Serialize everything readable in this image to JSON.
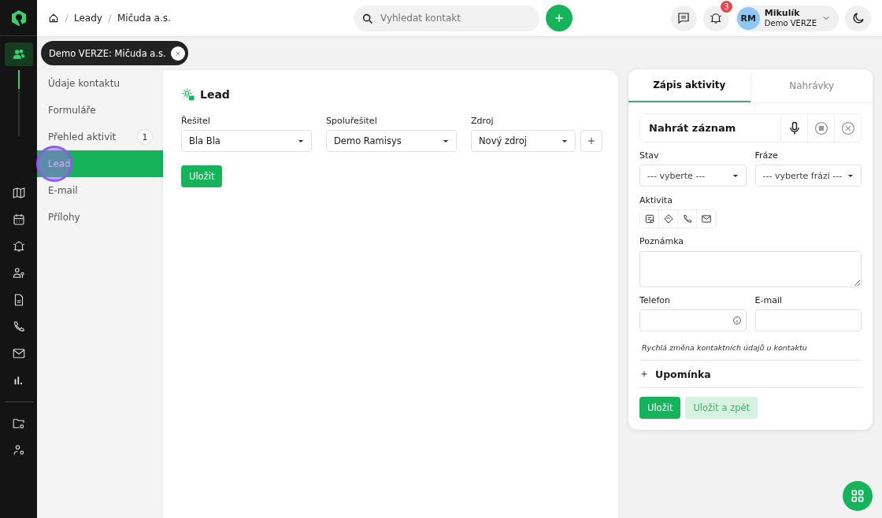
{
  "rail": {
    "items": [
      {
        "kind": "people",
        "selected": true
      },
      {
        "kind": "map",
        "selected": false
      },
      {
        "kind": "calendar",
        "selected": false
      },
      {
        "kind": "bell",
        "selected": false
      },
      {
        "kind": "user-key",
        "selected": false
      },
      {
        "kind": "document",
        "selected": false
      },
      {
        "kind": "phone",
        "selected": false
      },
      {
        "kind": "mail",
        "selected": false
      },
      {
        "kind": "chart",
        "selected": false
      }
    ],
    "bottom_items": [
      {
        "kind": "folder-gear",
        "selected": false
      },
      {
        "kind": "user-gear",
        "selected": false
      }
    ]
  },
  "header": {
    "breadcrumb": [
      "Leady",
      "Mičuda a.s."
    ],
    "search": {
      "placeholder": "Vyhledat kontakt"
    },
    "notifications": "3",
    "user": {
      "initials": "RM",
      "name": "Mikulík",
      "org": "Demo VERZE"
    }
  },
  "chip": {
    "label": "Demo VERZE: Mičuda a.s."
  },
  "menu": [
    {
      "label": "Údaje kontaktu",
      "selected": false
    },
    {
      "label": "Formuláře",
      "selected": false
    },
    {
      "label": "Přehled aktivit",
      "selected": false,
      "badge": "1"
    },
    {
      "label": "Lead",
      "selected": true
    },
    {
      "label": "E-mail",
      "selected": false
    },
    {
      "label": "Přílohy",
      "selected": false
    }
  ],
  "lead": {
    "title": "Lead",
    "fields": [
      {
        "label": "Řešitel",
        "value": "Bla Bla",
        "add_button": false
      },
      {
        "label": "Spoluřešitel",
        "value": "Demo Ramisys",
        "add_button": false
      },
      {
        "label": "Zdroj",
        "value": "Nový zdroj",
        "add_button": true
      }
    ],
    "save": "Uložit"
  },
  "panel": {
    "tabs": [
      {
        "label": "Zápis aktivity",
        "selected": true
      },
      {
        "label": "Nahrávky",
        "selected": false
      }
    ],
    "record": "Nahrát záznam",
    "status": {
      "label": "Stav",
      "value": "--- vyberte ---"
    },
    "phrase": {
      "label": "Fráze",
      "value": "--- vyberte frázi ---"
    },
    "activity": {
      "label": "Aktivita",
      "types": [
        {
          "kind": "note"
        },
        {
          "kind": "handshake"
        },
        {
          "kind": "phone"
        },
        {
          "kind": "mail"
        }
      ]
    },
    "note": {
      "label": "Poznámka"
    },
    "phone": {
      "label": "Telefon"
    },
    "email": {
      "label": "E-mail"
    },
    "hint": "Rychlá změna kontaktních údajů u kontaktu",
    "reminder": "Upomínka",
    "buttons": [
      {
        "label": "Uložit",
        "kind": "primary"
      },
      {
        "label": "Uložit a zpět",
        "kind": "secondary"
      }
    ]
  },
  "click_indicator": true
}
